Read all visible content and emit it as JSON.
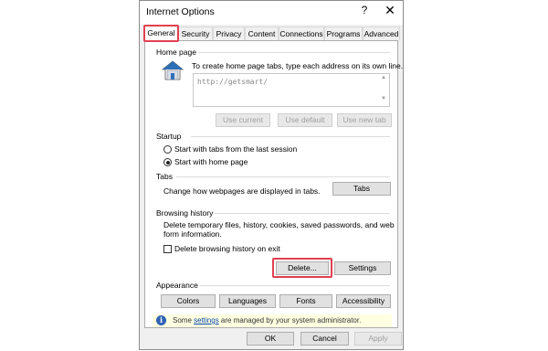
{
  "window": {
    "title": "Internet Options",
    "help_label": "?",
    "close_label": "✕"
  },
  "tabs": [
    "General",
    "Security",
    "Privacy",
    "Content",
    "Connections",
    "Programs",
    "Advanced"
  ],
  "active_tab": "General",
  "home_page": {
    "section": "Home page",
    "description": "To create home page tabs, type each address on its own line.",
    "url_value": "http://getsmart/",
    "buttons": {
      "use_current": "Use current",
      "use_default": "Use default",
      "use_new_tab": "Use new tab"
    }
  },
  "startup": {
    "section": "Startup",
    "options": [
      "Start with tabs from the last session",
      "Start with home page"
    ],
    "selected": "Start with home page"
  },
  "tabs_section": {
    "section": "Tabs",
    "description": "Change how webpages are displayed in tabs.",
    "button": "Tabs"
  },
  "browsing_history": {
    "section": "Browsing history",
    "description_line1": "Delete temporary files, history, cookies, saved passwords, and web",
    "description_line2": "form information.",
    "checkbox_label": "Delete browsing history on exit",
    "checkbox_checked": false,
    "delete_button": "Delete...",
    "settings_button": "Settings"
  },
  "appearance": {
    "section": "Appearance",
    "buttons": {
      "colors": "Colors",
      "languages": "Languages",
      "fonts": "Fonts",
      "accessibility": "Accessibility"
    }
  },
  "info_bar": {
    "prefix": "Some ",
    "link": "settings",
    "suffix": " are managed by your system administrator."
  },
  "footer": {
    "ok": "OK",
    "cancel": "Cancel",
    "apply": "Apply"
  },
  "colors": {
    "highlight": "#e04050",
    "link": "#0645ad",
    "info_bg": "#ffffe1",
    "house_roof": "#2f6fb8"
  }
}
